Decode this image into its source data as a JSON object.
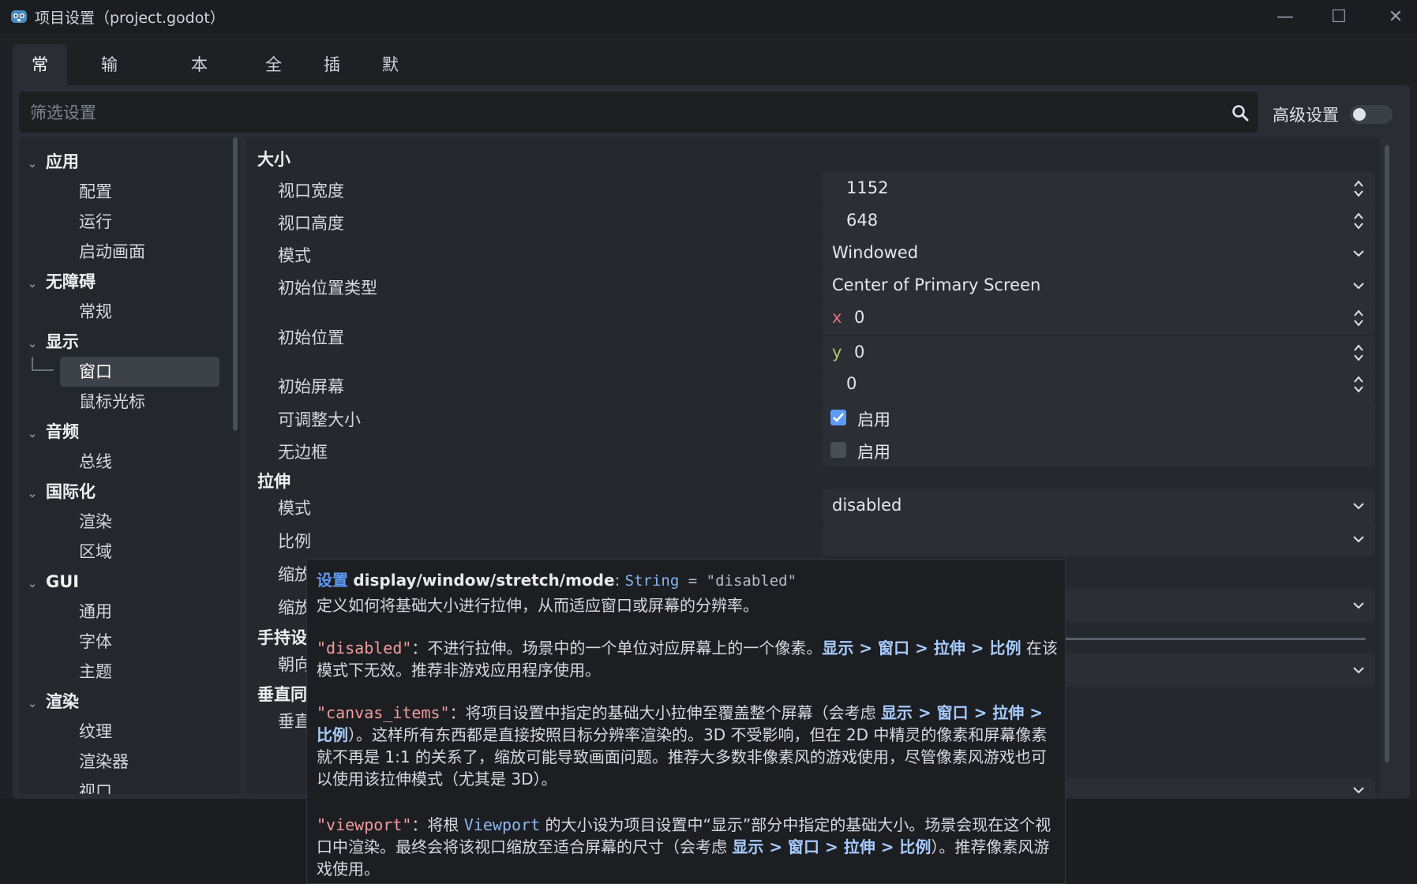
{
  "window": {
    "title": "项目设置（project.godot）",
    "controls": {
      "minimize": "—",
      "maximize": "☐",
      "close": "✕"
    }
  },
  "tabs": [
    "常规",
    "输入映射",
    "本地化",
    "全局",
    "插件",
    "默认导入设置"
  ],
  "active_tab": "常规",
  "filter": {
    "placeholder": "筛选设置",
    "value": ""
  },
  "advanced_settings": {
    "label": "高级设置",
    "enabled": false
  },
  "sidebar": {
    "categories": [
      {
        "label": "应用",
        "items": [
          "配置",
          "运行",
          "启动画面"
        ]
      },
      {
        "label": "无障碍",
        "items": [
          "常规"
        ]
      },
      {
        "label": "显示",
        "items": [
          "窗口",
          "鼠标光标"
        ]
      },
      {
        "label": "音频",
        "items": [
          "总线"
        ]
      },
      {
        "label": "国际化",
        "items": [
          "渲染",
          "区域"
        ]
      },
      {
        "label": "GUI",
        "items": [
          "通用",
          "字体",
          "主题"
        ]
      },
      {
        "label": "渲染",
        "items": [
          "纹理",
          "渲染器",
          "视口"
        ]
      }
    ],
    "selected": "窗口"
  },
  "settings": {
    "section_size": "大小",
    "viewport_width": {
      "label": "视口宽度",
      "value": "1152"
    },
    "viewport_height": {
      "label": "视口高度",
      "value": "648"
    },
    "mode": {
      "label": "模式",
      "value": "Windowed"
    },
    "initial_position_type": {
      "label": "初始位置类型",
      "value": "Center of Primary Screen"
    },
    "initial_position": {
      "label": "初始位置",
      "x_label": "x",
      "x": "0",
      "y_label": "y",
      "y": "0"
    },
    "initial_screen": {
      "label": "初始屏幕",
      "value": "0"
    },
    "resizable": {
      "label": "可调整大小",
      "checked": true,
      "text": "启用"
    },
    "borderless": {
      "label": "无边框",
      "checked": false,
      "text": "启用"
    },
    "section_stretch": "拉伸",
    "stretch_mode": {
      "label": "模式",
      "value": "disabled"
    },
    "stretch_aspect_label": "比例",
    "stretch_scale_label": "缩放",
    "stretch_scale_mode_label": "缩放",
    "section_handheld": "手持设",
    "handheld_orientation_label": "朝向",
    "section_vsync": "垂直同",
    "vsync_mode_label": "垂直"
  },
  "tooltip": {
    "keyword": "设置",
    "path": "display/window/stretch/mode",
    "colon": ": ",
    "type": "String",
    "default": " = \"disabled\"",
    "intro": "定义如何将基础大小进行拉伸，从而适应窗口或屏幕的分辨率。",
    "p1_code": "\"disabled\"",
    "p1_text_a": "：不进行拉伸。场景中的一个单位对应屏幕上的一个像素。",
    "p1_link": "显示 > 窗口 > 拉伸 > 比例",
    "p1_text_b": " 在该模式下无效。推荐非游戏应用程序使用。",
    "p2_code": "\"canvas_items\"",
    "p2_text_a": "：将项目设置中指定的基础大小拉伸至覆盖整个屏幕（会考虑 ",
    "p2_link": "显示 > 窗口 > 拉伸 > 比例",
    "p2_text_b": "）。这样所有东西都是直接按照目标分辨率渲染的。3D 不受影响，但在 2D 中精灵的像素和屏幕像素就不再是 1:1 的关系了，缩放可能导致画面问题。推荐大多数非像素风的游戏使用，尽管像素风游戏也可以使用该拉伸模式（尤其是 3D）。",
    "p3_code": "\"viewport\"",
    "p3_text_a": "：将根 ",
    "p3_class": "Viewport",
    "p3_text_b": " 的大小设为项目设置中“显示”部分中指定的基础大小。场景会现在这个视口中渲染。最终会将该视口缩放至适合屏幕的尺寸（会考虑 ",
    "p3_link": "显示 > 窗口 > 拉伸 > 比例",
    "p3_text_c": "）。推荐像素风游戏使用。"
  }
}
